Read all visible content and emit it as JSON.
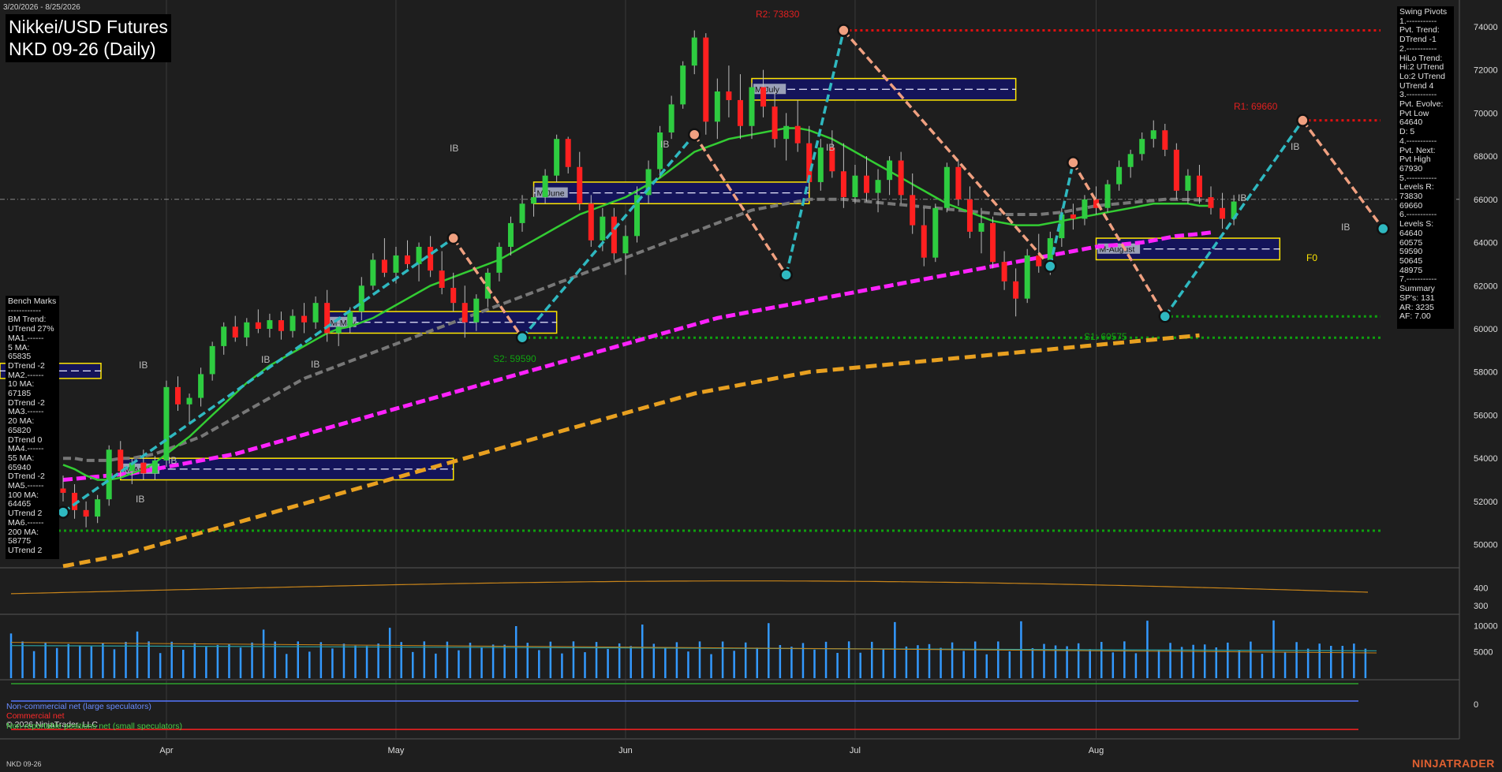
{
  "header": {
    "date_range": "3/20/2026 - 8/25/2026",
    "title_line1": "Nikkei/USD Futures",
    "title_line2": "NKD 09-26 (Daily)"
  },
  "swing_pivots": {
    "lines": [
      "Swing Pivots",
      "1.-----------",
      "Pvt. Trend:",
      "DTrend -1",
      "2.-----------",
      "HiLo Trend:",
      "Hi:2 UTrend",
      "Lo:2 UTrend",
      "UTrend 4",
      "3.-----------",
      "Pvt. Evolve:",
      "Pvt Low",
      "64640",
      "D: 5",
      "4.-----------",
      "Pvt. Next:",
      "Pvt High",
      "67930",
      "5.-----------",
      "Levels R:",
      "73830",
      "69660",
      "6.-----------",
      "Levels S:",
      "64640",
      "60575",
      "59590",
      "50645",
      "48975",
      "7.-----------",
      "Summary",
      "SP's: 131",
      "AR: 3235",
      "AF: 7.00"
    ]
  },
  "bench_marks": {
    "lines": [
      "Bench Marks",
      "------------",
      "BM Trend:",
      "UTrend 27%",
      "MA1.------",
      "5 MA:",
      "65835",
      "DTrend -2",
      "MA2.------",
      "10 MA:",
      "67185",
      "DTrend -2",
      "MA3.------",
      "20 MA:",
      "65820",
      "DTrend 0",
      "MA4.------",
      "55 MA:",
      "65940",
      "DTrend -2",
      "MA5.------",
      "100 MA:",
      "64465",
      "UTrend 2",
      "MA6.------",
      "200 MA:",
      "58775",
      "UTrend 2"
    ]
  },
  "annotations": {
    "r2": "R2: 73830",
    "r1": "R1: 69660",
    "s2": "S2: 59590",
    "s1": "S1: 60575",
    "ib": "IB",
    "f0": "F0"
  },
  "month_boxes": [
    "M-April",
    "M-May",
    "M-June",
    "M-July",
    "M-August"
  ],
  "legend": {
    "noncommercial": "Non-commercial net (large speculators)",
    "commercial": "Commercial net",
    "nonreportable": "Non-reportable positions net (small speculators)",
    "copyright": "© 2026 NinjaTrader, LLC"
  },
  "footer": {
    "instrument": "NKD 09-26",
    "brand": "NINJATRADER"
  },
  "colors": {
    "up": "#2ecc40",
    "down": "#ff2020",
    "ma_green": "#33cc33",
    "ma_gray": "#777777",
    "ma_magenta": "#ff22ff",
    "ma_orange": "#e8a020",
    "swing_up": "#2fb8c0",
    "swing_down": "#f0a080",
    "volume": "#3399ff"
  },
  "chart_data": {
    "type": "candlestick",
    "y_ticks": [
      50000,
      52000,
      54000,
      56000,
      58000,
      60000,
      62000,
      64000,
      66000,
      68000,
      70000,
      72000,
      74000
    ],
    "ylim": [
      49000,
      74800
    ],
    "x_month_labels": [
      {
        "label": "Apr",
        "index": 9
      },
      {
        "label": "May",
        "index": 29
      },
      {
        "label": "Jun",
        "index": 49
      },
      {
        "label": "Jul",
        "index": 69
      },
      {
        "label": "Aug",
        "index": 90
      }
    ],
    "candles": [
      [
        52600,
        53200,
        52000,
        52400
      ],
      [
        52400,
        52800,
        51200,
        51600
      ],
      [
        51600,
        52000,
        50800,
        51300
      ],
      [
        51300,
        52300,
        51000,
        52100
      ],
      [
        52100,
        54600,
        51800,
        54400
      ],
      [
        54400,
        54800,
        53100,
        53400
      ],
      [
        53400,
        54000,
        52800,
        53800
      ],
      [
        53800,
        54400,
        53000,
        53300
      ],
      [
        53300,
        54100,
        53000,
        53900
      ],
      [
        53900,
        57600,
        53600,
        57300
      ],
      [
        57300,
        57800,
        56200,
        56500
      ],
      [
        56500,
        57000,
        55600,
        56800
      ],
      [
        56800,
        58200,
        56400,
        57900
      ],
      [
        57900,
        59400,
        57600,
        59200
      ],
      [
        59200,
        60300,
        58800,
        60100
      ],
      [
        60100,
        60600,
        59400,
        59600
      ],
      [
        59600,
        60500,
        59200,
        60300
      ],
      [
        60300,
        60900,
        59800,
        60000
      ],
      [
        60000,
        60700,
        59600,
        60400
      ],
      [
        60400,
        60800,
        59500,
        59900
      ],
      [
        59900,
        60900,
        59600,
        60600
      ],
      [
        60600,
        61200,
        59800,
        60300
      ],
      [
        60300,
        61500,
        60000,
        61200
      ],
      [
        61200,
        61800,
        59400,
        59800
      ],
      [
        59800,
        60400,
        59200,
        60100
      ],
      [
        60100,
        61000,
        59800,
        60800
      ],
      [
        60800,
        62400,
        60400,
        62000
      ],
      [
        62000,
        63500,
        61800,
        63200
      ],
      [
        63200,
        64200,
        62400,
        62600
      ],
      [
        62600,
        63800,
        62100,
        63400
      ],
      [
        63400,
        64100,
        62800,
        63000
      ],
      [
        63000,
        64000,
        62200,
        63800
      ],
      [
        63800,
        64300,
        62400,
        62700
      ],
      [
        62700,
        63600,
        61600,
        61900
      ],
      [
        61900,
        62600,
        60800,
        61200
      ],
      [
        61200,
        62000,
        59590,
        60300
      ],
      [
        60300,
        61600,
        59900,
        61400
      ],
      [
        61400,
        62800,
        61000,
        62600
      ],
      [
        62600,
        64000,
        62200,
        63800
      ],
      [
        63800,
        65200,
        63400,
        64900
      ],
      [
        64900,
        66200,
        64500,
        65800
      ],
      [
        65800,
        66600,
        65200,
        66100
      ],
      [
        66100,
        67400,
        65800,
        67100
      ],
      [
        67100,
        69000,
        66800,
        68800
      ],
      [
        68800,
        68900,
        67200,
        67500
      ],
      [
        67500,
        68200,
        65500,
        65800
      ],
      [
        65800,
        66200,
        63800,
        64100
      ],
      [
        64100,
        65600,
        63600,
        65200
      ],
      [
        65200,
        65600,
        63200,
        63500
      ],
      [
        63500,
        64800,
        62500,
        64300
      ],
      [
        64300,
        66600,
        64000,
        66200
      ],
      [
        66200,
        67800,
        65800,
        67400
      ],
      [
        67400,
        69400,
        67000,
        69100
      ],
      [
        69100,
        70800,
        68800,
        70400
      ],
      [
        70400,
        72400,
        70200,
        72200
      ],
      [
        72200,
        73830,
        71800,
        73500
      ],
      [
        73500,
        73700,
        69000,
        69600
      ],
      [
        69600,
        71600,
        68800,
        71000
      ],
      [
        71000,
        72200,
        69800,
        70600
      ],
      [
        70600,
        71800,
        68800,
        69400
      ],
      [
        69400,
        71400,
        68800,
        71200
      ],
      [
        71200,
        72000,
        69800,
        70300
      ],
      [
        70300,
        71000,
        68400,
        68800
      ],
      [
        68800,
        70000,
        67800,
        69400
      ],
      [
        69400,
        70600,
        68200,
        68600
      ],
      [
        68600,
        69400,
        66400,
        66800
      ],
      [
        66800,
        68800,
        66400,
        68400
      ],
      [
        68400,
        69200,
        67000,
        67300
      ],
      [
        67300,
        68600,
        65600,
        66100
      ],
      [
        66100,
        67600,
        65800,
        67100
      ],
      [
        67100,
        68000,
        65900,
        66300
      ],
      [
        66300,
        67400,
        65400,
        66900
      ],
      [
        66900,
        68000,
        66200,
        67800
      ],
      [
        67800,
        68200,
        65800,
        66200
      ],
      [
        66200,
        67200,
        64400,
        64800
      ],
      [
        64800,
        65600,
        62900,
        63300
      ],
      [
        63300,
        65800,
        63100,
        65600
      ],
      [
        65600,
        67700,
        65400,
        67500
      ],
      [
        67500,
        67800,
        65700,
        66000
      ],
      [
        66000,
        66600,
        64200,
        64500
      ],
      [
        64500,
        65600,
        63500,
        64900
      ],
      [
        64900,
        65200,
        62800,
        63100
      ],
      [
        63100,
        63600,
        61800,
        62200
      ],
      [
        62200,
        62800,
        60575,
        61400
      ],
      [
        61400,
        63700,
        61200,
        63400
      ],
      [
        63400,
        64400,
        62600,
        62900
      ],
      [
        62900,
        64500,
        62500,
        64200
      ],
      [
        64200,
        65600,
        63800,
        65300
      ],
      [
        65300,
        65800,
        64600,
        65100
      ],
      [
        65100,
        66200,
        64800,
        66000
      ],
      [
        66000,
        66600,
        65300,
        65600
      ],
      [
        65600,
        66900,
        65400,
        66700
      ],
      [
        66700,
        67800,
        66400,
        67500
      ],
      [
        67500,
        68300,
        67000,
        68100
      ],
      [
        68100,
        69100,
        67800,
        68800
      ],
      [
        68800,
        69660,
        68400,
        69200
      ],
      [
        69200,
        69500,
        68000,
        68300
      ],
      [
        68300,
        68600,
        66000,
        66400
      ],
      [
        66400,
        67400,
        65800,
        67100
      ],
      [
        67100,
        67600,
        65800,
        66100
      ],
      [
        66100,
        66600,
        65300,
        65600
      ],
      [
        65600,
        66300,
        64640,
        65100
      ],
      [
        65100,
        66200,
        64800,
        65900
      ]
    ],
    "ma_values": {
      "ma20_green": [
        53700,
        53500,
        53200,
        53000,
        53000,
        53100,
        53300,
        53500,
        53800,
        54200,
        54600,
        55000,
        55500,
        56000,
        56500,
        57000,
        57500,
        57900,
        58300,
        58600,
        58900,
        59200,
        59500,
        59800,
        60000,
        60100,
        60300,
        60500,
        60800,
        61100,
        61400,
        61700,
        62000,
        62200,
        62400,
        62600,
        62800,
        63000,
        63200,
        63500,
        63800,
        64100,
        64400,
        64700,
        65000,
        65300,
        65500,
        65700,
        65900,
        66100,
        66400,
        66700,
        67000,
        67400,
        67800,
        68200,
        68400,
        68600,
        68800,
        68900,
        69000,
        69100,
        69200,
        69300,
        69300,
        69200,
        69000,
        68800,
        68500,
        68200,
        67900,
        67600,
        67300,
        67000,
        66700,
        66400,
        66100,
        65800,
        65600,
        65400,
        65200,
        65000,
        64900,
        64800,
        64800,
        64800,
        64900,
        65000,
        65100,
        65200,
        65300,
        65400,
        65500,
        65600,
        65700,
        65800,
        65800,
        65800,
        65800,
        65700,
        65700
      ],
      "ma55_gray": [
        54000,
        54000,
        53900,
        53900,
        53900,
        54000,
        54000,
        54100,
        54200,
        54400,
        54600,
        54800,
        55000,
        55300,
        55600,
        55900,
        56200,
        56500,
        56800,
        57100,
        57400,
        57700,
        57900,
        58100,
        58300,
        58500,
        58700,
        58900,
        59100,
        59300,
        59500,
        59700,
        59900,
        60100,
        60300,
        60500,
        60700,
        60900,
        61100,
        61300,
        61500,
        61700,
        61900,
        62100,
        62300,
        62500,
        62700,
        62900,
        63100,
        63300,
        63500,
        63700,
        63900,
        64100,
        64300,
        64500,
        64700,
        64900,
        65100,
        65300,
        65500,
        65600,
        65700,
        65800,
        65900,
        66000,
        66000,
        66000,
        66000,
        65950,
        65900,
        65850,
        65800,
        65750,
        65700,
        65650,
        65600,
        65550,
        65500,
        65450,
        65400,
        65350,
        65300,
        65300,
        65300,
        65300,
        65350,
        65400,
        65500,
        65600,
        65700,
        65750,
        65800,
        65850,
        65900,
        65950,
        66000,
        66000,
        65990,
        65970,
        65940
      ],
      "ma100_magenta": [
        53000,
        53050,
        53100,
        53150,
        53200,
        53250,
        53300,
        53400,
        53500,
        53600,
        53700,
        53800,
        53900,
        54000,
        54100,
        54200,
        54350,
        54500,
        54650,
        54800,
        54950,
        55100,
        55250,
        55400,
        55550,
        55700,
        55850,
        56000,
        56150,
        56300,
        56450,
        56600,
        56750,
        56900,
        57050,
        57200,
        57350,
        57500,
        57650,
        57800,
        57950,
        58100,
        58250,
        58400,
        58550,
        58700,
        58850,
        59000,
        59150,
        59300,
        59450,
        59600,
        59750,
        59900,
        60050,
        60200,
        60350,
        60500,
        60600,
        60700,
        60800,
        60900,
        61000,
        61100,
        61200,
        61300,
        61400,
        61500,
        61600,
        61700,
        61800,
        61900,
        62000,
        62100,
        62200,
        62300,
        62400,
        62500,
        62600,
        62700,
        62800,
        62900,
        63000,
        63100,
        63200,
        63300,
        63400,
        63500,
        63600,
        63700,
        63800,
        63850,
        63900,
        63950,
        64000,
        64100,
        64200,
        64300,
        64350,
        64400,
        64465
      ],
      "ma200_orange": [
        49000,
        49100,
        49200,
        49300,
        49400,
        49500,
        49650,
        49800,
        49950,
        50100,
        50250,
        50400,
        50550,
        50700,
        50850,
        51000,
        51150,
        51300,
        51450,
        51600,
        51750,
        51900,
        52050,
        52200,
        52350,
        52500,
        52650,
        52800,
        52950,
        53100,
        53250,
        53400,
        53550,
        53700,
        53850,
        54000,
        54150,
        54300,
        54450,
        54600,
        54750,
        54900,
        55050,
        55200,
        55350,
        55500,
        55650,
        55800,
        55950,
        56100,
        56250,
        56400,
        56550,
        56700,
        56850,
        57000,
        57100,
        57200,
        57300,
        57400,
        57500,
        57600,
        57700,
        57800,
        57900,
        58000,
        58050,
        58100,
        58150,
        58200,
        58250,
        58300,
        58350,
        58400,
        58450,
        58500,
        58550,
        58600,
        58650,
        58700,
        58750,
        58800,
        58850,
        58900,
        58950,
        59000,
        59050,
        59100,
        59150,
        59200,
        59250,
        59300,
        59350,
        59400,
        59450,
        59500,
        59550,
        59600,
        59650,
        59700,
        58775
      ]
    },
    "swing_points": [
      {
        "index": 0,
        "price": 51500,
        "type": "low"
      },
      {
        "index": 34,
        "price": 64200,
        "type": "high"
      },
      {
        "index": 40,
        "price": 59590,
        "type": "low"
      },
      {
        "index": 55,
        "price": 69000,
        "type": "high"
      },
      {
        "index": 63,
        "price": 62500,
        "type": "low"
      },
      {
        "index": 68,
        "price": 73830,
        "type": "high"
      },
      {
        "index": 86,
        "price": 62900,
        "type": "low"
      },
      {
        "index": 88,
        "price": 67700,
        "type": "high"
      },
      {
        "index": 96,
        "price": 60575,
        "type": "low"
      },
      {
        "index": 108,
        "price": 69660,
        "type": "high"
      },
      {
        "index": 115,
        "price": 64640,
        "type": "low"
      }
    ],
    "levels": {
      "R2": 73830,
      "R1": 69660,
      "S2": 59590,
      "S1": 60575,
      "S_low": 50645
    },
    "indicator_panel": {
      "y_ticks": [
        300,
        400
      ],
      "ylim": [
        250,
        500
      ]
    },
    "volume_panel": {
      "y_ticks": [
        5000,
        10000
      ],
      "ylim": [
        0,
        12000
      ]
    },
    "cot_panel": {
      "y_ticks": [
        0
      ]
    }
  }
}
